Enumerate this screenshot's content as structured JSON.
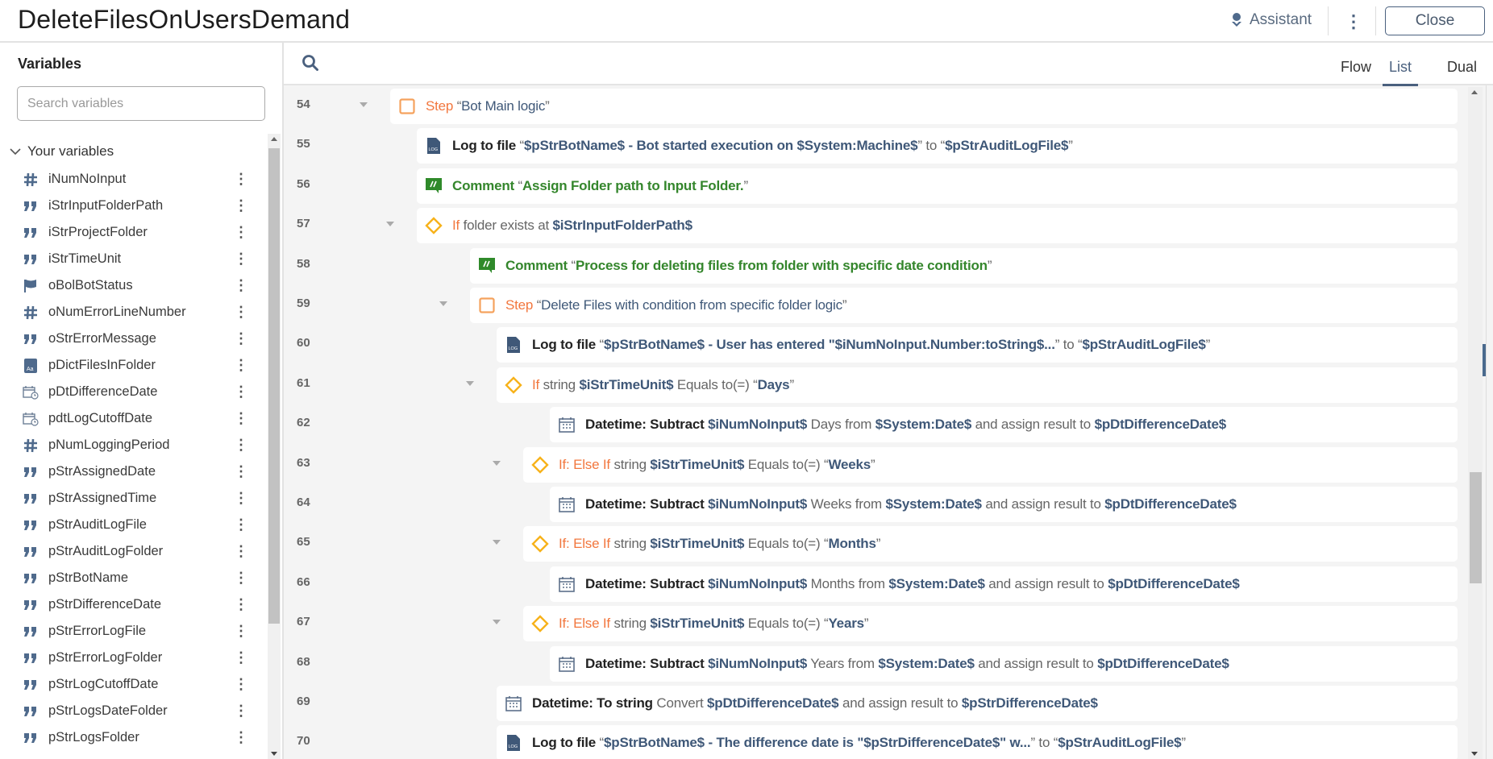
{
  "header": {
    "title": "DeleteFilesOnUsersDemand",
    "assistant_label": "Assistant",
    "close_label": "Close"
  },
  "sidebar": {
    "title": "Variables",
    "search_placeholder": "Search variables",
    "group_label": "Your variables",
    "variables": [
      {
        "name": "iNumNoInput",
        "icon": "number"
      },
      {
        "name": "iStrInputFolderPath",
        "icon": "string"
      },
      {
        "name": "iStrProjectFolder",
        "icon": "string"
      },
      {
        "name": "iStrTimeUnit",
        "icon": "string"
      },
      {
        "name": "oBolBotStatus",
        "icon": "boolean"
      },
      {
        "name": "oNumErrorLineNumber",
        "icon": "number"
      },
      {
        "name": "oStrErrorMessage",
        "icon": "string"
      },
      {
        "name": "pDictFilesInFolder",
        "icon": "dictionary"
      },
      {
        "name": "pDtDifferenceDate",
        "icon": "datetime"
      },
      {
        "name": "pdtLogCutoffDate",
        "icon": "datetime"
      },
      {
        "name": "pNumLoggingPeriod",
        "icon": "number"
      },
      {
        "name": "pStrAssignedDate",
        "icon": "string"
      },
      {
        "name": "pStrAssignedTime",
        "icon": "string"
      },
      {
        "name": "pStrAuditLogFile",
        "icon": "string"
      },
      {
        "name": "pStrAuditLogFolder",
        "icon": "string"
      },
      {
        "name": "pStrBotName",
        "icon": "string"
      },
      {
        "name": "pStrDifferenceDate",
        "icon": "string"
      },
      {
        "name": "pStrErrorLogFile",
        "icon": "string"
      },
      {
        "name": "pStrErrorLogFolder",
        "icon": "string"
      },
      {
        "name": "pStrLogCutoffDate",
        "icon": "string"
      },
      {
        "name": "pStrLogsDateFolder",
        "icon": "string"
      },
      {
        "name": "pStrLogsFolder",
        "icon": "string"
      }
    ]
  },
  "toolbar": {
    "views": [
      "Flow",
      "List",
      "Dual"
    ],
    "active_view": "List"
  },
  "colors": {
    "accent": "#4a607e",
    "keyword_orange": "#f2773e",
    "comment_green": "#34862c",
    "variable_blue": "#3f5878"
  },
  "rows": [
    {
      "line": "54",
      "icon": "step",
      "toggle": true,
      "parts": [
        [
          "k-step",
          "Step"
        ],
        [
          "g",
          " “"
        ],
        [
          "q",
          "Bot Main logic"
        ],
        [
          "g",
          "”"
        ]
      ]
    },
    {
      "line": "55",
      "icon": "log",
      "parts": [
        [
          "k-cmd",
          "Log to file"
        ],
        [
          "g",
          " “"
        ],
        [
          "v",
          "$pStrBotName$ - Bot started execution on $System:Machine$"
        ],
        [
          "g",
          "” to “"
        ],
        [
          "v",
          "$pStrAuditLogFile$"
        ],
        [
          "g",
          "”"
        ]
      ]
    },
    {
      "line": "56",
      "icon": "comment",
      "parts": [
        [
          "k-cmt",
          "Comment"
        ],
        [
          "g",
          " “"
        ],
        [
          "cg",
          "Assign Folder path to Input Folder."
        ],
        [
          "g",
          "”"
        ]
      ]
    },
    {
      "line": "57",
      "icon": "if",
      "toggle": true,
      "parts": [
        [
          "k-if",
          "If"
        ],
        [
          "g",
          " folder exists at "
        ],
        [
          "v",
          "$iStrInputFolderPath$"
        ]
      ]
    },
    {
      "line": "58",
      "icon": "comment",
      "parts": [
        [
          "k-cmt",
          "Comment"
        ],
        [
          "g",
          " “"
        ],
        [
          "cg",
          "Process for deleting files from folder with specific date condition"
        ],
        [
          "g",
          "”"
        ]
      ]
    },
    {
      "line": "59",
      "icon": "step",
      "toggle": true,
      "parts": [
        [
          "k-step",
          "Step"
        ],
        [
          "g",
          " “"
        ],
        [
          "q",
          "Delete Files with condition from specific folder logic"
        ],
        [
          "g",
          "”"
        ]
      ]
    },
    {
      "line": "60",
      "icon": "log",
      "parts": [
        [
          "k-cmd",
          "Log to file"
        ],
        [
          "g",
          " “"
        ],
        [
          "v",
          "$pStrBotName$ - User has entered \"$iNumNoInput.Number:toString$..."
        ],
        [
          "g",
          "” to “"
        ],
        [
          "v",
          "$pStrAuditLogFile$"
        ],
        [
          "g",
          "”"
        ]
      ]
    },
    {
      "line": "61",
      "icon": "if",
      "toggle": true,
      "parts": [
        [
          "k-if",
          "If"
        ],
        [
          "g",
          " string "
        ],
        [
          "v",
          "$iStrTimeUnit$"
        ],
        [
          "g",
          " Equals to(=) “"
        ],
        [
          "v",
          "Days"
        ],
        [
          "g",
          "”"
        ]
      ]
    },
    {
      "line": "62",
      "icon": "datetime",
      "parts": [
        [
          "k-cmd",
          "Datetime: Subtract"
        ],
        [
          "g",
          " "
        ],
        [
          "v",
          "$iNumNoInput$"
        ],
        [
          "g",
          " Days from "
        ],
        [
          "v",
          "$System:Date$"
        ],
        [
          "g",
          " and assign result to "
        ],
        [
          "v",
          "$pDtDifferenceDate$"
        ]
      ]
    },
    {
      "line": "63",
      "icon": "if",
      "toggle": true,
      "parts": [
        [
          "k-if",
          "If: Else If"
        ],
        [
          "g",
          " string "
        ],
        [
          "v",
          "$iStrTimeUnit$"
        ],
        [
          "g",
          " Equals to(=) “"
        ],
        [
          "v",
          "Weeks"
        ],
        [
          "g",
          "”"
        ]
      ]
    },
    {
      "line": "64",
      "icon": "datetime",
      "parts": [
        [
          "k-cmd",
          "Datetime: Subtract"
        ],
        [
          "g",
          " "
        ],
        [
          "v",
          "$iNumNoInput$"
        ],
        [
          "g",
          " Weeks from "
        ],
        [
          "v",
          "$System:Date$"
        ],
        [
          "g",
          " and assign result to "
        ],
        [
          "v",
          "$pDtDifferenceDate$"
        ]
      ]
    },
    {
      "line": "65",
      "icon": "if",
      "toggle": true,
      "parts": [
        [
          "k-if",
          "If: Else If"
        ],
        [
          "g",
          " string "
        ],
        [
          "v",
          "$iStrTimeUnit$"
        ],
        [
          "g",
          " Equals to(=) “"
        ],
        [
          "v",
          "Months"
        ],
        [
          "g",
          "”"
        ]
      ]
    },
    {
      "line": "66",
      "icon": "datetime",
      "parts": [
        [
          "k-cmd",
          "Datetime: Subtract"
        ],
        [
          "g",
          " "
        ],
        [
          "v",
          "$iNumNoInput$"
        ],
        [
          "g",
          " Months from "
        ],
        [
          "v",
          "$System:Date$"
        ],
        [
          "g",
          " and assign result to "
        ],
        [
          "v",
          "$pDtDifferenceDate$"
        ]
      ]
    },
    {
      "line": "67",
      "icon": "if",
      "toggle": true,
      "parts": [
        [
          "k-if",
          "If: Else If"
        ],
        [
          "g",
          " string "
        ],
        [
          "v",
          "$iStrTimeUnit$"
        ],
        [
          "g",
          " Equals to(=) “"
        ],
        [
          "v",
          "Years"
        ],
        [
          "g",
          "”"
        ]
      ]
    },
    {
      "line": "68",
      "icon": "datetime",
      "parts": [
        [
          "k-cmd",
          "Datetime: Subtract"
        ],
        [
          "g",
          " "
        ],
        [
          "v",
          "$iNumNoInput$"
        ],
        [
          "g",
          " Years from "
        ],
        [
          "v",
          "$System:Date$"
        ],
        [
          "g",
          " and assign result to "
        ],
        [
          "v",
          "$pDtDifferenceDate$"
        ]
      ]
    },
    {
      "line": "69",
      "icon": "datetime",
      "parts": [
        [
          "k-cmd",
          "Datetime: To string"
        ],
        [
          "g",
          " Convert "
        ],
        [
          "v",
          "$pDtDifferenceDate$"
        ],
        [
          "g",
          " and assign result to "
        ],
        [
          "v",
          "$pStrDifferenceDate$"
        ]
      ]
    },
    {
      "line": "70",
      "icon": "log",
      "parts": [
        [
          "k-cmd",
          "Log to file"
        ],
        [
          "g",
          " “"
        ],
        [
          "v",
          "$pStrBotName$ - The difference date is \"$pStrDifferenceDate$\" w..."
        ],
        [
          "g",
          "” to “"
        ],
        [
          "v",
          "$pStrAuditLogFile$"
        ],
        [
          "g",
          "”"
        ]
      ]
    }
  ]
}
